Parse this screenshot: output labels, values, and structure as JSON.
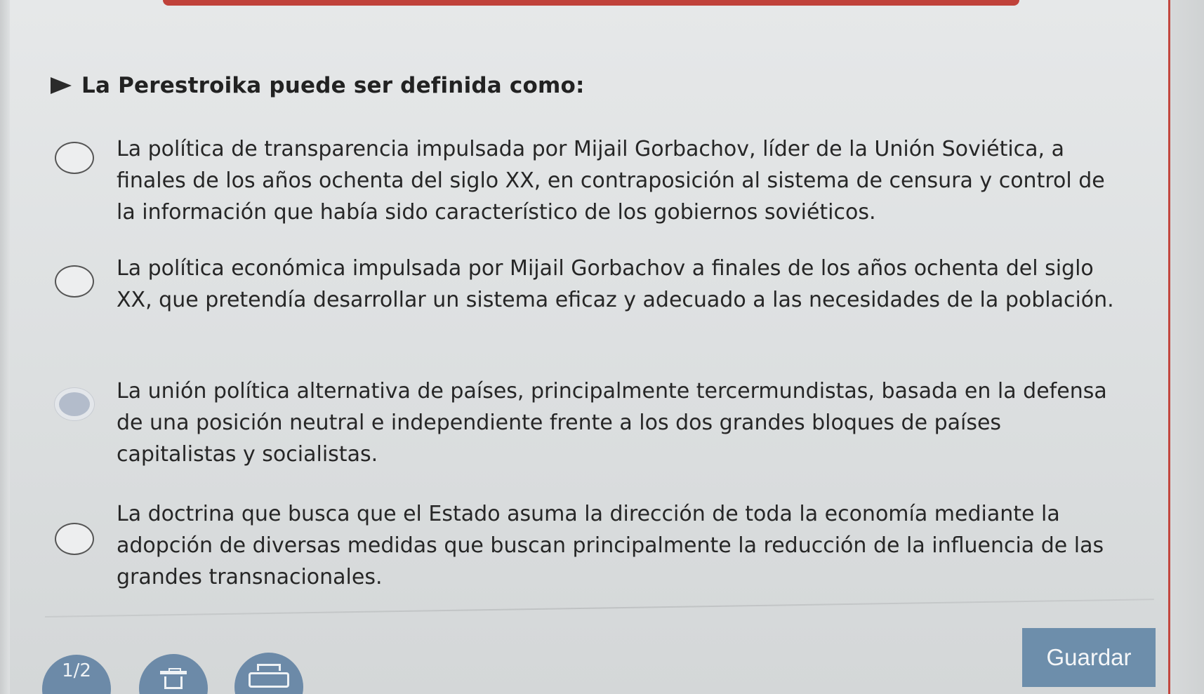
{
  "question": {
    "text": "La Perestroika puede ser definida como:"
  },
  "options": [
    {
      "text": "La política de transparencia impulsada por Mijail Gorbachov, líder de la Unión Soviética, a finales de los años ochenta del siglo XX, en contraposición al sistema de censura y control de la información que había sido característico de los gobiernos soviéticos.",
      "selected": false
    },
    {
      "text": "La política económica impulsada por Mijail Gorbachov a finales de los años ochenta del siglo XX, que pretendía desarrollar un sistema eficaz y adecuado a las necesidades de la población.",
      "selected": false
    },
    {
      "text": "La unión política alternativa de países, principalmente tercermundistas, basada en la defensa de una posición neutral e independiente frente a los dos grandes bloques de países capitalistas y socialistas.",
      "selected": true
    },
    {
      "text": "La doctrina que busca que el Estado asuma la dirección de toda la economía mediante la adopción de diversas medidas que buscan principalmente la reducción de la influencia de las grandes transnacionales.",
      "selected": false
    }
  ],
  "footer": {
    "save_label": "Guardar",
    "page_indicator": "1/2",
    "trash_icon": "trash-icon",
    "print_icon": "printer-icon"
  },
  "colors": {
    "accent_red": "#c0423a",
    "button_blue": "#6d8eab",
    "selected_radio": "#b3bccb"
  }
}
